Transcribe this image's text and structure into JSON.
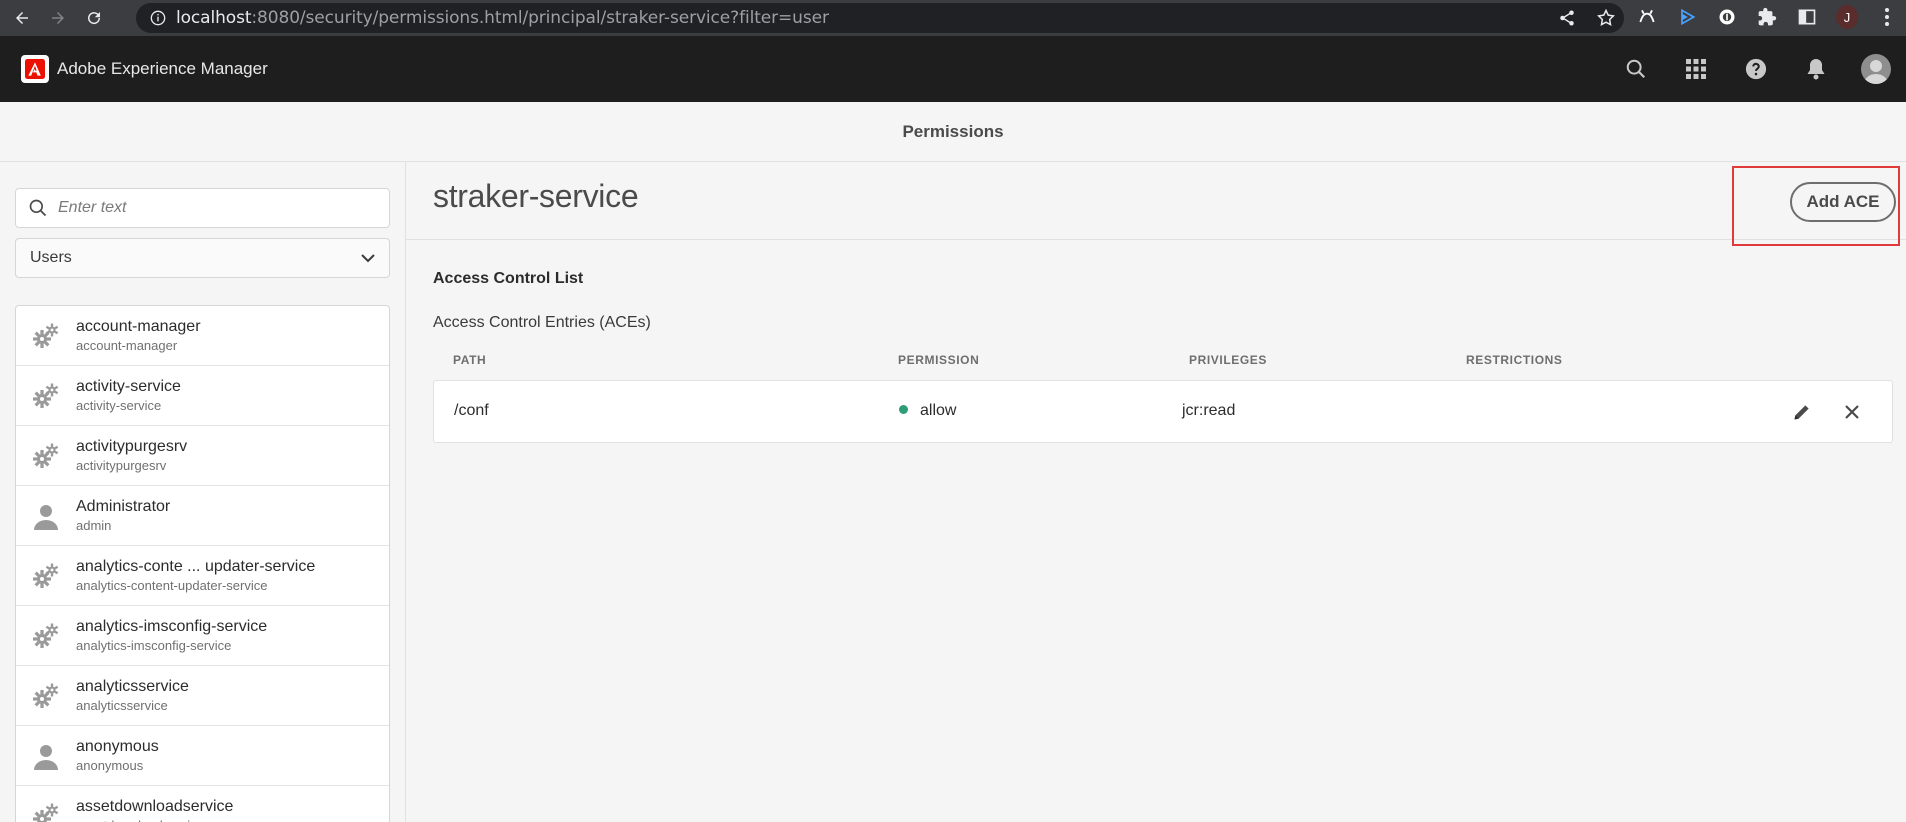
{
  "browser": {
    "url_host": "localhost",
    "url_rest": ":8080/security/permissions.html/principal/straker-service?filter=user",
    "profile_initial": "J"
  },
  "app": {
    "title": "Adobe Experience Manager"
  },
  "page": {
    "title": "Permissions"
  },
  "sidebar": {
    "search_placeholder": "Enter text",
    "filter_value": "Users",
    "users": [
      {
        "name": "account-manager",
        "id": "account-manager",
        "type": "service"
      },
      {
        "name": "activity-service",
        "id": "activity-service",
        "type": "service"
      },
      {
        "name": "activitypurgesrv",
        "id": "activitypurgesrv",
        "type": "service"
      },
      {
        "name": "Administrator",
        "id": "admin",
        "type": "user"
      },
      {
        "name": "analytics-conte ... updater-service",
        "id": "analytics-content-updater-service",
        "type": "service"
      },
      {
        "name": "analytics-imsconfig-service",
        "id": "analytics-imsconfig-service",
        "type": "service"
      },
      {
        "name": "analyticsservice",
        "id": "analyticsservice",
        "type": "service"
      },
      {
        "name": "anonymous",
        "id": "anonymous",
        "type": "user"
      },
      {
        "name": "assetdownloadservice",
        "id": "assetdownloadservice",
        "type": "service"
      }
    ]
  },
  "main": {
    "principal": "straker-service",
    "add_ace_label": "Add ACE",
    "acl_title": "Access Control List",
    "aces_title": "Access Control Entries (ACEs)",
    "columns": {
      "path": "PATH",
      "permission": "PERMISSION",
      "privileges": "PRIVILEGES",
      "restrictions": "RESTRICTIONS"
    },
    "entries": [
      {
        "path": "/conf",
        "permission": "allow",
        "privileges": "jcr:read",
        "restrictions": ""
      }
    ]
  },
  "colors": {
    "highlight": "#e03a3a",
    "allow": "#2d9d78",
    "header_bg": "#1e1e1e",
    "adobe_red": "#eb1000"
  }
}
